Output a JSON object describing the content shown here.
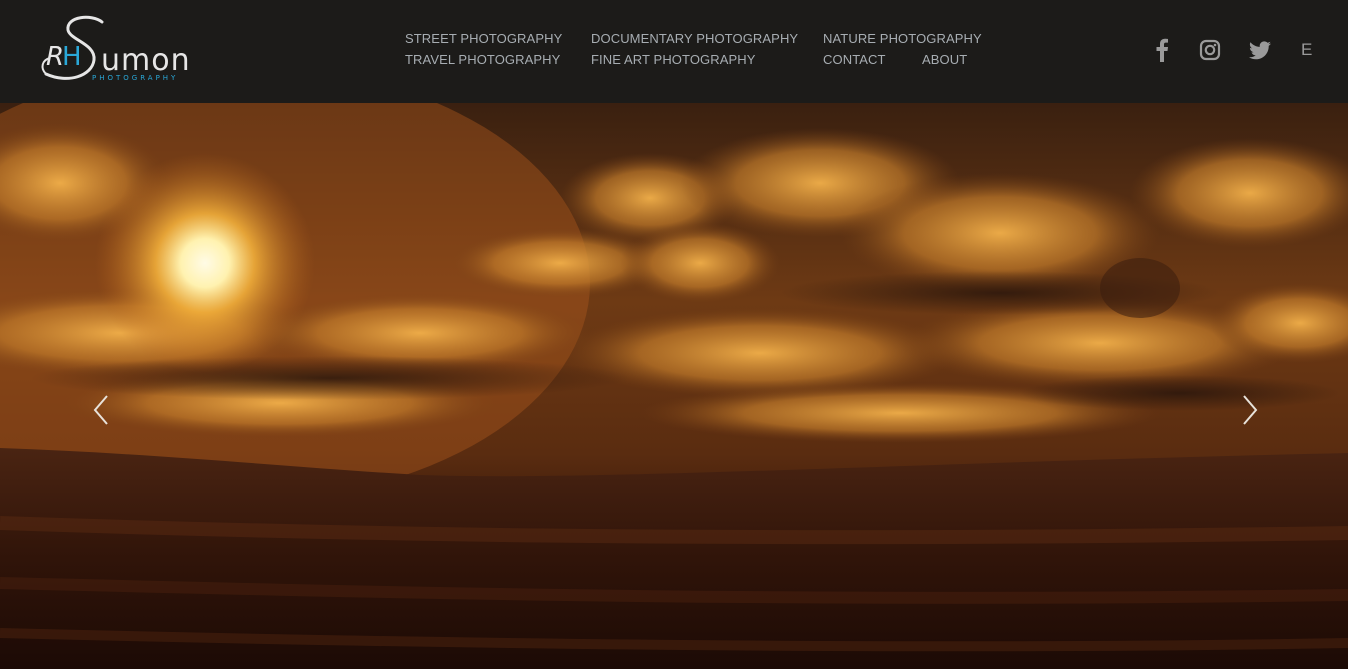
{
  "logo": {
    "initials": "RH",
    "name": "umon",
    "tagline": "PHOTOGRAPHY"
  },
  "nav": {
    "street": "STREET PHOTOGRAPHY",
    "travel": "TRAVEL PHOTOGRAPHY",
    "documentary": "DOCUMENTARY PHOTOGRAPHY",
    "fine_art": "FINE ART PHOTOGRAPHY",
    "nature": "NATURE PHOTOGRAPHY",
    "contact": "CONTACT",
    "about": "ABOUT"
  },
  "social": {
    "icons": [
      "facebook-icon",
      "instagram-icon",
      "twitter-icon"
    ],
    "language": "E"
  },
  "slider": {
    "prev_icon": "chevron-left-icon",
    "next_icon": "chevron-right-icon"
  },
  "colors": {
    "header_bg": "#1c1b19",
    "nav_text": "#a7adb2",
    "logo_accent": "#2aa8d8"
  }
}
